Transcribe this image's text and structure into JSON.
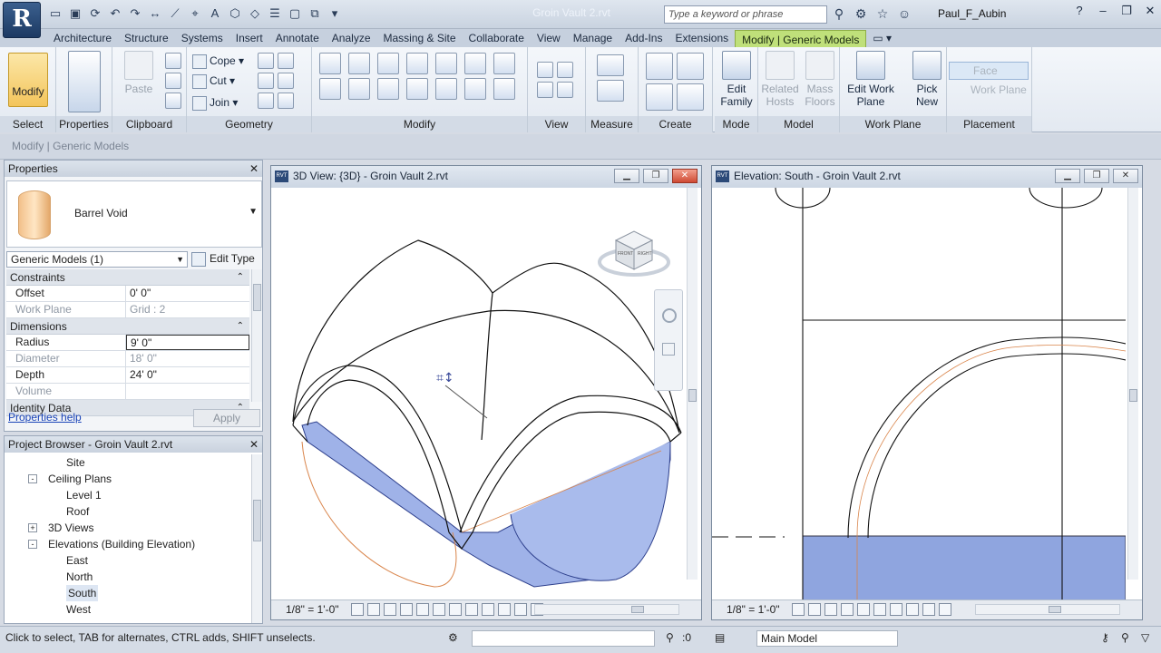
{
  "app": {
    "logo": "R",
    "title": "Groin Vault 2.rvt",
    "search_placeholder": "Type a keyword or phrase",
    "user": "Paul_F_Aubin"
  },
  "tabs": [
    "Architecture",
    "Structure",
    "Systems",
    "Insert",
    "Annotate",
    "Analyze",
    "Massing & Site",
    "Collaborate",
    "View",
    "Manage",
    "Add-Ins",
    "Extensions",
    "Modify | Generic Models"
  ],
  "active_tab": "Modify | Generic Models",
  "ribbon": {
    "select": {
      "modify_label": "Modify",
      "panel": "Select"
    },
    "properties": {
      "panel": "Properties"
    },
    "clipboard": {
      "paste_label": "Paste",
      "panel": "Clipboard"
    },
    "geometry": {
      "cope": "Cope",
      "cut": "Cut",
      "join": "Join",
      "panel": "Geometry"
    },
    "modify": {
      "panel": "Modify"
    },
    "view": {
      "panel": "View"
    },
    "measure": {
      "panel": "Measure"
    },
    "create": {
      "panel": "Create"
    },
    "mode": {
      "edit_family": "Edit Family",
      "panel": "Mode"
    },
    "model": {
      "related_hosts": "Related Hosts",
      "mass_floors": "Mass Floors",
      "panel": "Model"
    },
    "work_plane": {
      "edit_work_plane": "Edit Work Plane",
      "pick_new": "Pick New",
      "panel": "Work Plane"
    },
    "placement": {
      "face": "Face",
      "work_plane": "Work Plane",
      "panel": "Placement"
    }
  },
  "context_bar": "Modify | Generic Models",
  "properties": {
    "title": "Properties",
    "type_name": "Barrel Void",
    "instance_selector": "Generic Models (1)",
    "edit_type": "Edit Type",
    "groups": [
      {
        "name": "Constraints",
        "rows": [
          {
            "key": "Offset",
            "value": "0' 0\"",
            "dim": false
          },
          {
            "key": "Work Plane",
            "value": "Grid : 2",
            "dim": true
          }
        ]
      },
      {
        "name": "Dimensions",
        "rows": [
          {
            "key": "Radius",
            "value": "9' 0\"",
            "dim": false,
            "editing": true
          },
          {
            "key": "Diameter",
            "value": "18' 0\"",
            "dim": true
          },
          {
            "key": "Depth",
            "value": "24' 0\"",
            "dim": false
          },
          {
            "key": "Volume",
            "value": "",
            "dim": true
          }
        ]
      },
      {
        "name": "Identity Data",
        "rows": []
      }
    ],
    "help_link": "Properties help",
    "apply": "Apply"
  },
  "project_browser": {
    "title": "Project Browser - Groin Vault 2.rvt",
    "nodes": [
      {
        "label": "Site",
        "level": 3
      },
      {
        "label": "Ceiling Plans",
        "level": 2,
        "toggle": "-"
      },
      {
        "label": "Level 1",
        "level": 3
      },
      {
        "label": "Roof",
        "level": 3
      },
      {
        "label": "3D Views",
        "level": 2,
        "toggle": "+"
      },
      {
        "label": "Elevations (Building Elevation)",
        "level": 2,
        "toggle": "-"
      },
      {
        "label": "East",
        "level": 3
      },
      {
        "label": "North",
        "level": 3
      },
      {
        "label": "South",
        "level": 3,
        "selected": true
      },
      {
        "label": "West",
        "level": 3
      }
    ]
  },
  "views": {
    "view3d": {
      "title": "3D View: {3D} - Groin Vault 2.rvt",
      "scale": "1/8\" = 1'-0\""
    },
    "elevation": {
      "title": "Elevation: South - Groin Vault 2.rvt",
      "scale": "1/8\" = 1'-0\""
    }
  },
  "viewcube": {
    "front": "FRONT",
    "right": "RIGHT"
  },
  "status": {
    "message": "Click to select, TAB for alternates, CTRL adds, SHIFT unselects.",
    "selection_count": ":0",
    "model": "Main Model"
  },
  "colors": {
    "accent_tab": "#bfe07a",
    "void_fill": "#8da3e0",
    "outline_orange": "#d9844a"
  }
}
